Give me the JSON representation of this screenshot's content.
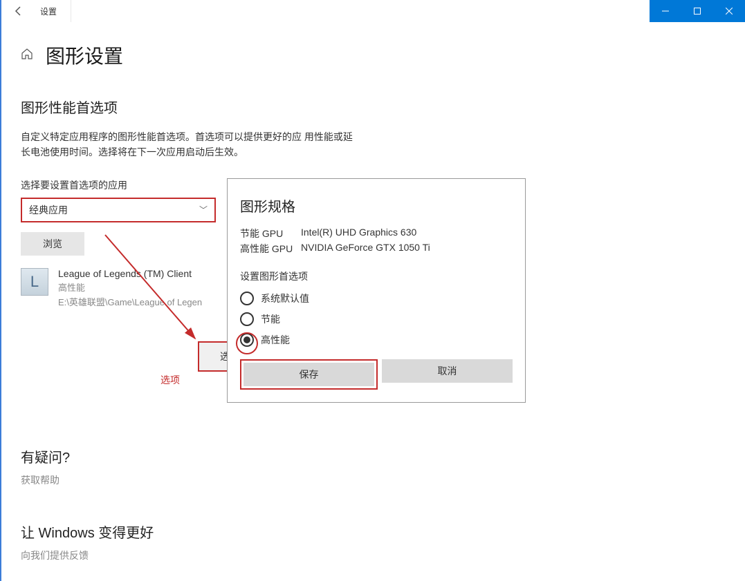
{
  "titlebar": {
    "title": "设置"
  },
  "page": {
    "title": "图形设置",
    "section_title": "图形性能首选项",
    "description": "自定义特定应用程序的图形性能首选项。首选项可以提供更好的应\n用性能或延长电池使用时间。选择将在下一次应用启动后生效。",
    "select_label": "选择要设置首选项的应用",
    "dropdown_value": "经典应用",
    "browse_label": "浏览"
  },
  "app": {
    "name": "League of Legends (TM) Client",
    "perf": "高性能",
    "path": "E:\\英雄联盟\\Game\\League of Legen",
    "icon_letter": "L"
  },
  "annotation": {
    "options_label": "选项",
    "stub_text": "选"
  },
  "dialog": {
    "title": "图形规格",
    "eco_gpu_label": "节能 GPU",
    "eco_gpu_value": "Intel(R) UHD Graphics 630",
    "perf_gpu_label": "高性能 GPU",
    "perf_gpu_value": "NVIDIA GeForce GTX 1050 Ti",
    "pref_title": "设置图形首选项",
    "radio_default": "系统默认值",
    "radio_eco": "节能",
    "radio_perf": "高性能",
    "save": "保存",
    "cancel": "取消"
  },
  "help": {
    "q_title": "有疑问?",
    "get_help": "获取帮助",
    "improve_title": "让 Windows 变得更好",
    "feedback": "向我们提供反馈"
  }
}
